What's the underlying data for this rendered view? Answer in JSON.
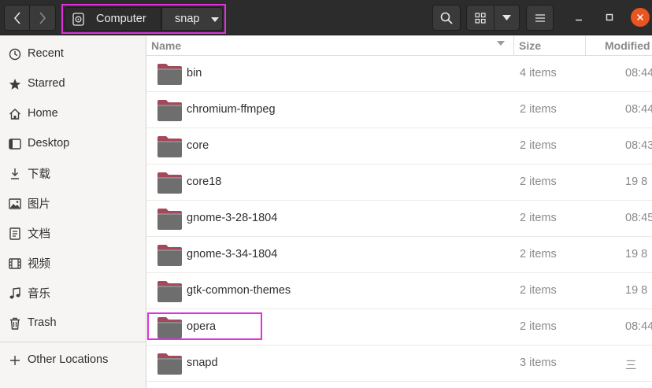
{
  "header": {
    "path": [
      "Computer",
      "snap"
    ]
  },
  "sidebar": {
    "items": [
      {
        "label": "Recent",
        "icon": "clock-icon"
      },
      {
        "label": "Starred",
        "icon": "star-icon"
      },
      {
        "label": "Home",
        "icon": "home-icon"
      },
      {
        "label": "Desktop",
        "icon": "desktop-icon"
      },
      {
        "label": "下载",
        "icon": "download-icon"
      },
      {
        "label": "图片",
        "icon": "image-icon"
      },
      {
        "label": "文档",
        "icon": "document-icon"
      },
      {
        "label": "视频",
        "icon": "video-icon"
      },
      {
        "label": "音乐",
        "icon": "music-icon"
      },
      {
        "label": "Trash",
        "icon": "trash-icon"
      },
      {
        "label": "Other Locations",
        "icon": "plus-icon"
      }
    ]
  },
  "columns": {
    "name": "Name",
    "size": "Size",
    "modified": "Modified"
  },
  "files": [
    {
      "name": "bin",
      "size": "4 items",
      "modified": "08:44"
    },
    {
      "name": "chromium-ffmpeg",
      "size": "2 items",
      "modified": "08:44"
    },
    {
      "name": "core",
      "size": "2 items",
      "modified": "08:43"
    },
    {
      "name": "core18",
      "size": "2 items",
      "modified": "19 8"
    },
    {
      "name": "gnome-3-28-1804",
      "size": "2 items",
      "modified": "08:45"
    },
    {
      "name": "gnome-3-34-1804",
      "size": "2 items",
      "modified": "19 8"
    },
    {
      "name": "gtk-common-themes",
      "size": "2 items",
      "modified": "19 8"
    },
    {
      "name": "opera",
      "size": "2 items",
      "modified": "08:44"
    },
    {
      "name": "snapd",
      "size": "3 items",
      "modified": "三"
    }
  ],
  "colors": {
    "header_bg": "#2c2c2c",
    "highlight": "#e030e0",
    "folder_tab": "#a5495a",
    "folder_body": "#6e6e6e",
    "close_button": "#e95420"
  }
}
